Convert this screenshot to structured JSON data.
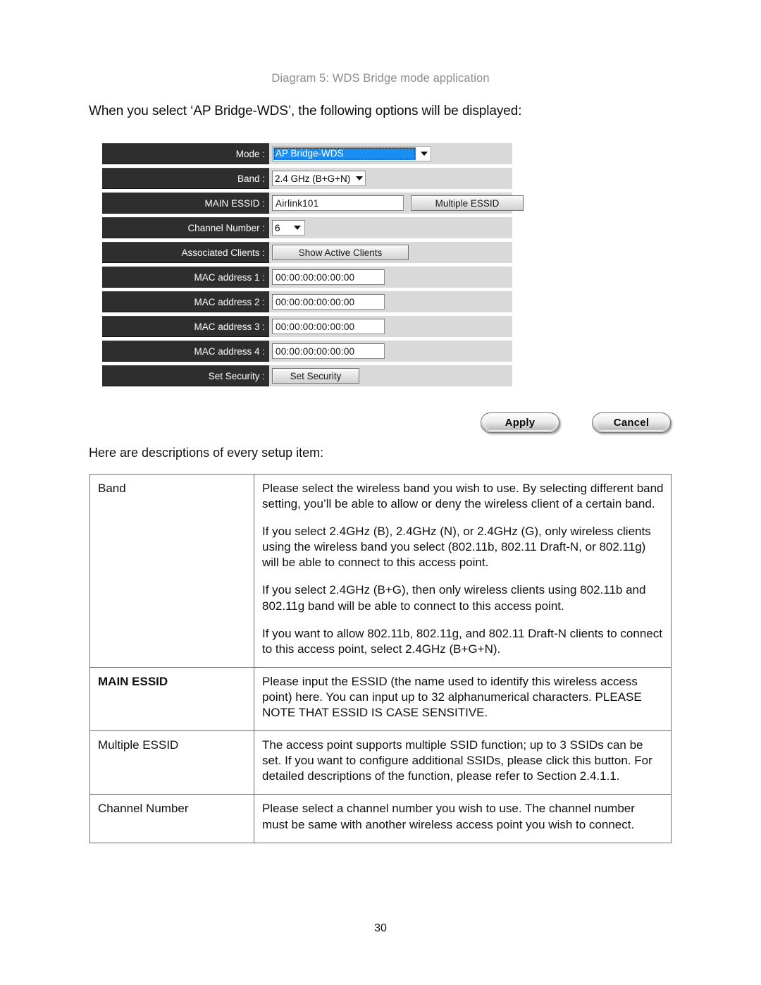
{
  "page": {
    "diagram_caption": "Diagram 5: WDS Bridge mode application",
    "intro_line": "When you select ‘AP Bridge-WDS’, the following options will be displayed:",
    "descriptions_lead": "Here are descriptions of every setup item:",
    "page_number": "30"
  },
  "config_panel": {
    "rows": [
      {
        "label": "Mode :",
        "value": "AP Bridge-WDS"
      },
      {
        "label": "Band :",
        "value": "2.4 GHz (B+G+N)"
      },
      {
        "label": "MAIN ESSID :",
        "value": "Airlink101",
        "button": "Multiple ESSID"
      },
      {
        "label": "Channel Number :",
        "value": "6"
      },
      {
        "label": "Associated Clients :",
        "button": "Show Active Clients"
      },
      {
        "label": "MAC address 1 :",
        "value": "00:00:00:00:00:00"
      },
      {
        "label": "MAC address 2 :",
        "value": "00:00:00:00:00:00"
      },
      {
        "label": "MAC address 3 :",
        "value": "00:00:00:00:00:00"
      },
      {
        "label": "MAC address 4 :",
        "value": "00:00:00:00:00:00"
      },
      {
        "label": "Set Security :",
        "button": "Set Security"
      }
    ],
    "selected_highlight_color": "#1b8ef2",
    "label_background_color": "#2e2e2e",
    "row_background_color": "#d9d9d9"
  },
  "actions": {
    "apply_label": "Apply",
    "cancel_label": "Cancel"
  },
  "descriptions": {
    "rows": [
      {
        "term": "Band",
        "bold": false,
        "paragraphs": [
          "Please select the wireless band you wish to use. By selecting different band setting, you’ll be able to allow or deny the wireless client of a certain band.",
          "If you select 2.4GHz (B), 2.4GHz (N), or 2.4GHz (G), only wireless clients using the wireless band you select (802.11b, 802.11 Draft-N, or 802.11g) will be able to connect to this access point.",
          "If you select 2.4GHz (B+G), then only wireless clients using 802.11b and 802.11g band will be able to connect to this access point.",
          "If you want to allow 802.11b, 802.11g, and 802.11 Draft-N clients to connect to this access point, select 2.4GHz (B+G+N)."
        ]
      },
      {
        "term": "MAIN ESSID",
        "bold": true,
        "paragraphs": [
          "Please input the ESSID (the name used to identify this wireless access point) here. You can input up to 32 alphanumerical characters. PLEASE NOTE   THAT ESSID IS CASE SENSITIVE."
        ]
      },
      {
        "term": "Multiple ESSID",
        "bold": false,
        "paragraphs": [
          "The access point supports multiple SSID function; up to 3 SSIDs can be set. If you want to configure additional SSIDs, please click this button. For detailed descriptions of the function, please refer to Section 2.4.1.1."
        ]
      },
      {
        "term": "Channel Number",
        "bold": false,
        "paragraphs": [
          "Please select a channel number you wish to use. The channel number must be same with another wireless access point you wish to connect."
        ]
      }
    ]
  }
}
